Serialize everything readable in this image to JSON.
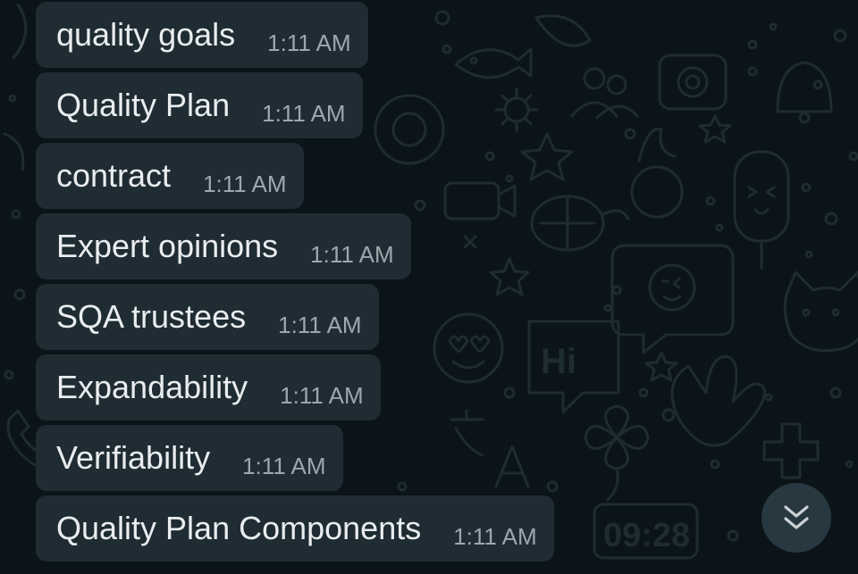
{
  "messages": [
    {
      "text": "quality goals",
      "time": "1:11 AM"
    },
    {
      "text": "Quality Plan",
      "time": "1:11 AM"
    },
    {
      "text": "contract",
      "time": "1:11 AM"
    },
    {
      "text": "Expert opinions",
      "time": "1:11 AM"
    },
    {
      "text": "SQA trustees",
      "time": "1:11 AM"
    },
    {
      "text": "Expandability",
      "time": "1:11 AM"
    },
    {
      "text": "Verifiability",
      "time": "1:11 AM"
    },
    {
      "text": "Quality Plan Components",
      "time": "1:11 AM"
    }
  ],
  "wallpaper": {
    "hi_text": "Hi",
    "clock_text": "09:28"
  },
  "scroll_button": {
    "icon": "double-chevron-down-icon"
  },
  "colors": {
    "background": "#0b1418",
    "bubble": "#1f2c33",
    "message_text": "#e9edef",
    "timestamp": "#9ba8ad",
    "scroll_button": "#283840"
  }
}
